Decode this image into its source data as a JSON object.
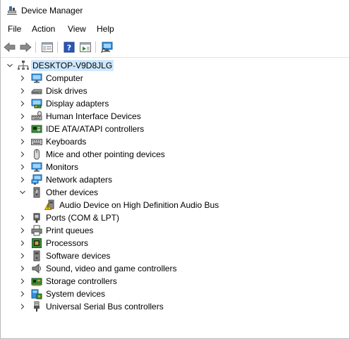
{
  "window": {
    "title": "Device Manager"
  },
  "menu": [
    "File",
    "Action",
    "View",
    "Help"
  ],
  "toolbar": {
    "buttons": [
      "back-icon",
      "forward-icon",
      "properties-icon",
      "help-icon",
      "driver-update-icon",
      "scan-hardware-icon"
    ]
  },
  "tree": {
    "root": {
      "label": "DESKTOP-V9D8JLG",
      "icon": "computer-network-icon",
      "expanded": true
    },
    "categories": [
      {
        "label": "Computer",
        "icon": "monitor-icon",
        "expanded": false
      },
      {
        "label": "Disk drives",
        "icon": "disk-drive-icon",
        "expanded": false
      },
      {
        "label": "Display adapters",
        "icon": "display-adapter-icon",
        "expanded": false
      },
      {
        "label": "Human Interface Devices",
        "icon": "hid-icon",
        "expanded": false
      },
      {
        "label": "IDE ATA/ATAPI controllers",
        "icon": "ide-controller-icon",
        "expanded": false
      },
      {
        "label": "Keyboards",
        "icon": "keyboard-icon",
        "expanded": false
      },
      {
        "label": "Mice and other pointing devices",
        "icon": "mouse-icon",
        "expanded": false
      },
      {
        "label": "Monitors",
        "icon": "monitor-icon",
        "expanded": false
      },
      {
        "label": "Network adapters",
        "icon": "network-adapter-icon",
        "expanded": false
      },
      {
        "label": "Other devices",
        "icon": "other-devices-icon",
        "expanded": true,
        "children": [
          {
            "label": "Audio Device on High Definition Audio Bus",
            "icon": "warning-device-icon"
          }
        ]
      },
      {
        "label": "Ports (COM & LPT)",
        "icon": "port-icon",
        "expanded": false
      },
      {
        "label": "Print queues",
        "icon": "printer-icon",
        "expanded": false
      },
      {
        "label": "Processors",
        "icon": "processor-icon",
        "expanded": false
      },
      {
        "label": "Software devices",
        "icon": "software-device-icon",
        "expanded": false
      },
      {
        "label": "Sound, video and game controllers",
        "icon": "speaker-icon",
        "expanded": false
      },
      {
        "label": "Storage controllers",
        "icon": "storage-controller-icon",
        "expanded": false
      },
      {
        "label": "System devices",
        "icon": "system-devices-icon",
        "expanded": false
      },
      {
        "label": "Universal Serial Bus controllers",
        "icon": "usb-icon",
        "expanded": false
      }
    ]
  },
  "colors": {
    "selection": "#cde8ff",
    "accent": "#0078d7",
    "warning": "#f2c200"
  }
}
